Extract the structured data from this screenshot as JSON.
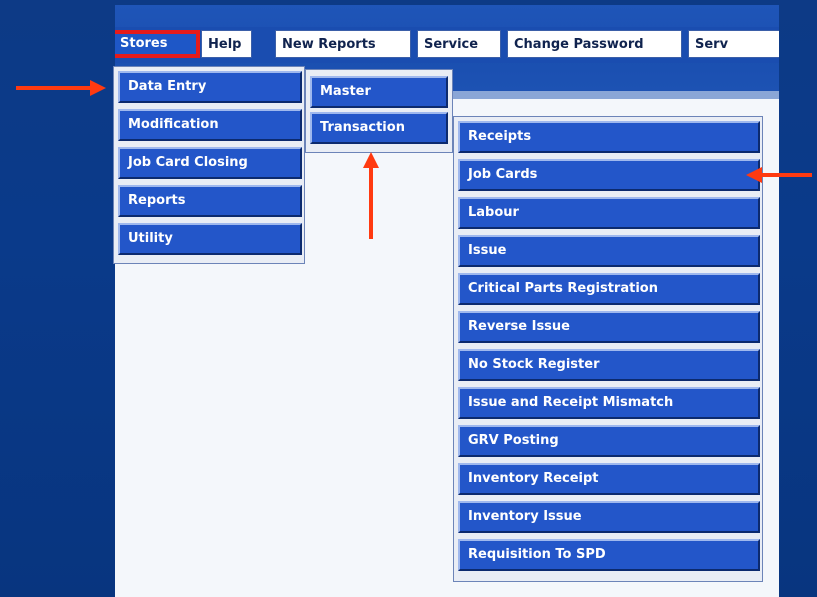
{
  "menubar": {
    "items": [
      {
        "label": "Stores"
      },
      {
        "label": "Help"
      },
      {
        "label": "New Reports"
      },
      {
        "label": "Service"
      },
      {
        "label": "Change Password"
      },
      {
        "label": "Serv"
      }
    ]
  },
  "stores_menu": {
    "items": [
      {
        "label": "Data Entry"
      },
      {
        "label": "Modification"
      },
      {
        "label": "Job Card Closing"
      },
      {
        "label": "Reports"
      },
      {
        "label": "Utility"
      }
    ]
  },
  "data_entry_menu": {
    "items": [
      {
        "label": "Master"
      },
      {
        "label": "Transaction"
      }
    ]
  },
  "transaction_menu": {
    "items": [
      {
        "label": "Receipts"
      },
      {
        "label": "Job Cards"
      },
      {
        "label": "Labour"
      },
      {
        "label": "Issue"
      },
      {
        "label": "Critical Parts Registration"
      },
      {
        "label": "Reverse Issue"
      },
      {
        "label": "No Stock Register"
      },
      {
        "label": "Issue and Receipt Mismatch"
      },
      {
        "label": "GRV Posting"
      },
      {
        "label": "Inventory Receipt"
      },
      {
        "label": "Inventory Issue"
      },
      {
        "label": "Requisition To SPD"
      }
    ]
  },
  "colors": {
    "background": "#0a3a8a",
    "menu_item": "#2356c9",
    "highlight_arrow": "#ff3a10",
    "active_border": "#e51b1b"
  }
}
